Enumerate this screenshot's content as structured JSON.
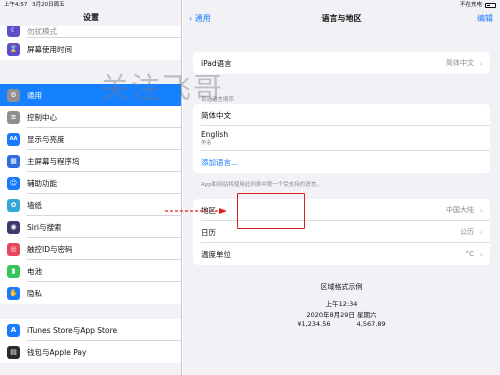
{
  "status_bar": {
    "time": "上午4:57",
    "date": "3月20日周五",
    "right": "不在充电"
  },
  "sidebar": {
    "title": "设置",
    "cut_item": "勿扰模式",
    "group1": [
      {
        "label": "屏幕使用时间",
        "icon": "hourglass-icon",
        "color": "#5b4fc9",
        "glyph": "⌛"
      }
    ],
    "group2": [
      {
        "label": "通用",
        "icon": "gear-icon",
        "color": "#8e8e93",
        "glyph": "⚙",
        "selected": true
      },
      {
        "label": "控制中心",
        "icon": "switches-icon",
        "color": "#8e8e93",
        "glyph": "≡"
      },
      {
        "label": "显示与亮度",
        "icon": "text-size-icon",
        "color": "#1a7aff",
        "glyph": "AA"
      },
      {
        "label": "主屏幕与程序坞",
        "icon": "grid-icon",
        "color": "#2f6bdc",
        "glyph": "▦"
      },
      {
        "label": "辅助功能",
        "icon": "accessibility-icon",
        "color": "#1a7aff",
        "glyph": "☺"
      },
      {
        "label": "墙纸",
        "icon": "flower-icon",
        "color": "#33a7d6",
        "glyph": "✿"
      },
      {
        "label": "Siri与搜索",
        "icon": "siri-icon",
        "color": "#3b3b6e",
        "glyph": "◉"
      },
      {
        "label": "触控ID与密码",
        "icon": "fingerprint-icon",
        "color": "#e8475b",
        "glyph": "◎"
      },
      {
        "label": "电池",
        "icon": "battery-icon",
        "color": "#34c759",
        "glyph": "▮"
      },
      {
        "label": "隐私",
        "icon": "hand-icon",
        "color": "#1a7aff",
        "glyph": "✋"
      }
    ],
    "group3": [
      {
        "label": "iTunes Store与App Store",
        "icon": "app-store-icon",
        "color": "#1a7aff",
        "glyph": "A"
      },
      {
        "label": "钱包与Apple Pay",
        "icon": "wallet-icon",
        "color": "#2c2c2e",
        "glyph": "▤"
      }
    ]
  },
  "main": {
    "back_label": "通用",
    "title": "语言与地区",
    "edit_label": "编辑",
    "ipad_language": {
      "label": "iPad语言",
      "value": "简体中文"
    },
    "preferred_header": "首选语言顺序",
    "languages": [
      {
        "name": "简体中文",
        "sub": ""
      },
      {
        "name": "English",
        "sub": "英语"
      }
    ],
    "add_language": "添加语言...",
    "language_footnote": "App和网站将使用此列表中第一个受支持的语言。",
    "region_rows": [
      {
        "label": "地区",
        "value": "中国大陆"
      },
      {
        "label": "日历",
        "value": "公历"
      },
      {
        "label": "温度单位",
        "value": "°C"
      }
    ],
    "format_example": {
      "title": "区域格式示例",
      "time": "上午12:34",
      "date": "2020年8月29日 星期六",
      "number1": "¥1,234.56",
      "number2": "4,567.89"
    }
  },
  "watermark": "关注飞哥",
  "colors": {
    "accent": "#1a7aff",
    "selected": "#1681ff",
    "annotation": "#e02020"
  }
}
